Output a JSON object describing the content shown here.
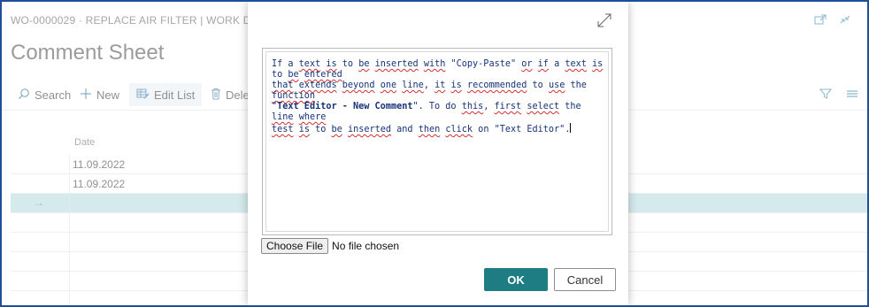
{
  "page": {
    "header": "WO-0000029 · REPLACE AIR FILTER | WORK DATE:",
    "title": "Comment Sheet"
  },
  "toolbar": {
    "search_label": "Search",
    "new_label": "New",
    "edit_list_label": "Edit List",
    "delete_label": "Dele"
  },
  "grid": {
    "column_date": "Date",
    "rows": [
      {
        "date": "11.09.2022"
      },
      {
        "date": "11.09.2022"
      },
      {
        "date": ""
      }
    ]
  },
  "dialog": {
    "editor_text_parts": [
      "If",
      "a",
      "text",
      "is",
      "to",
      "be",
      "inserted",
      "with",
      "\"Copy-Paste\"",
      "or",
      "if",
      "a",
      "text",
      "is",
      "to",
      "be",
      "entered"
    ],
    "line1_a": "If a ",
    "line1_b": "text",
    "line1_c": " ",
    "line1_d": "is",
    "line1_e": " to ",
    "line1_f": "be",
    "line1_g": " ",
    "line1_h": "inserted",
    "line1_i": " ",
    "line1_j": "with",
    "line1_k": " \"Copy-Paste\" ",
    "line1_l": "or",
    "line1_m": " ",
    "line1_n": "if",
    "line1_o": " a ",
    "line1_p": "text",
    "line1_q": " ",
    "line1_r": "is",
    "line1_s": " to ",
    "line1_t": "be",
    "line1_u": " ",
    "line1_v": "entered",
    "line2_a": "that",
    "line2_b": " ",
    "line2_c": "extends",
    "line2_d": " ",
    "line2_e": "beyond",
    "line2_f": " ",
    "line2_g": "one",
    "line2_h": " ",
    "line2_i": "line",
    "line2_j": ", ",
    "line2_k": "it",
    "line2_l": " ",
    "line2_m": "is",
    "line2_n": " ",
    "line2_o": "recommended",
    "line2_p": " to ",
    "line2_q": "use",
    "line2_r": " the ",
    "line2_s": "function",
    "line3_a": "\"",
    "line3_bold": "Text Editor - New Comment",
    "line3_c": "\". To do ",
    "line3_d": "this",
    "line3_e": ", ",
    "line3_f": "first",
    "line3_g": " ",
    "line3_h": "select",
    "line3_i": " the ",
    "line3_j": "line",
    "line3_k": " ",
    "line3_l": "where",
    "line4_a": "test",
    "line4_b": " ",
    "line4_c": "is",
    "line4_d": " to ",
    "line4_e": "be",
    "line4_f": " ",
    "line4_g": "inserted",
    "line4_h": " and ",
    "line4_i": "then",
    "line4_j": " ",
    "line4_k": "click",
    "line4_l": " on \"Text Editor\".",
    "choose_file_label": "Choose File",
    "no_file_text": "No file chosen",
    "ok_label": "OK",
    "cancel_label": "Cancel"
  },
  "colors": {
    "frame_border": "#1f4e9a",
    "accent": "#1e7d83",
    "selected_row": "#b3d9de",
    "editor_text": "#15337a",
    "spell_underline": "#d03030"
  },
  "icons": [
    "search-icon",
    "plus-icon",
    "edit-list-icon",
    "delete-icon",
    "open-new-window-icon",
    "collapse-icon",
    "filter-icon",
    "list-view-icon",
    "row-arrow-icon",
    "expand-icon"
  ]
}
